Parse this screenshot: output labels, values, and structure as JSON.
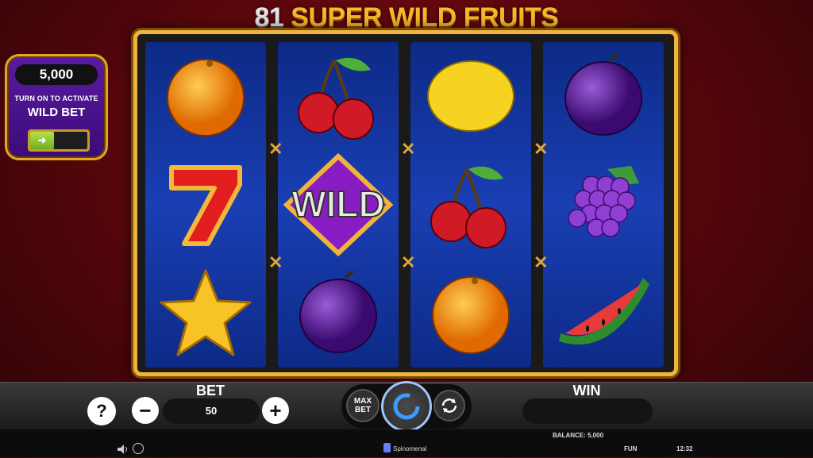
{
  "game": {
    "title_number": "81",
    "title_text": "SUPER WILD FRUITS"
  },
  "wild_panel": {
    "amount": "5,000",
    "hint": "TURN ON TO ACTIVATE",
    "label": "WILD BET",
    "toggle_on": false
  },
  "reels": [
    [
      "orange",
      "seven",
      "star"
    ],
    [
      "cherry",
      "wild",
      "plum"
    ],
    [
      "lemon",
      "cherry",
      "orange"
    ],
    [
      "plum",
      "grapes",
      "watermelon"
    ]
  ],
  "wild_symbol_text": "WILD",
  "controls": {
    "help_label": "?",
    "bet_title": "BET",
    "bet_value": "50",
    "minus_label": "−",
    "plus_label": "+",
    "max_bet_line1": "MAX",
    "max_bet_line2": "BET",
    "win_title": "WIN",
    "win_value": ""
  },
  "status": {
    "balance": "BALANCE: 5,000",
    "provider": "Spinomenal",
    "mode": "FUN",
    "time": "12:32"
  },
  "colors": {
    "gold": "#f0b43a",
    "reel_blue": "#1a3fb4",
    "panel_purple": "#5b1aa1",
    "background_red": "#8a0d14"
  }
}
